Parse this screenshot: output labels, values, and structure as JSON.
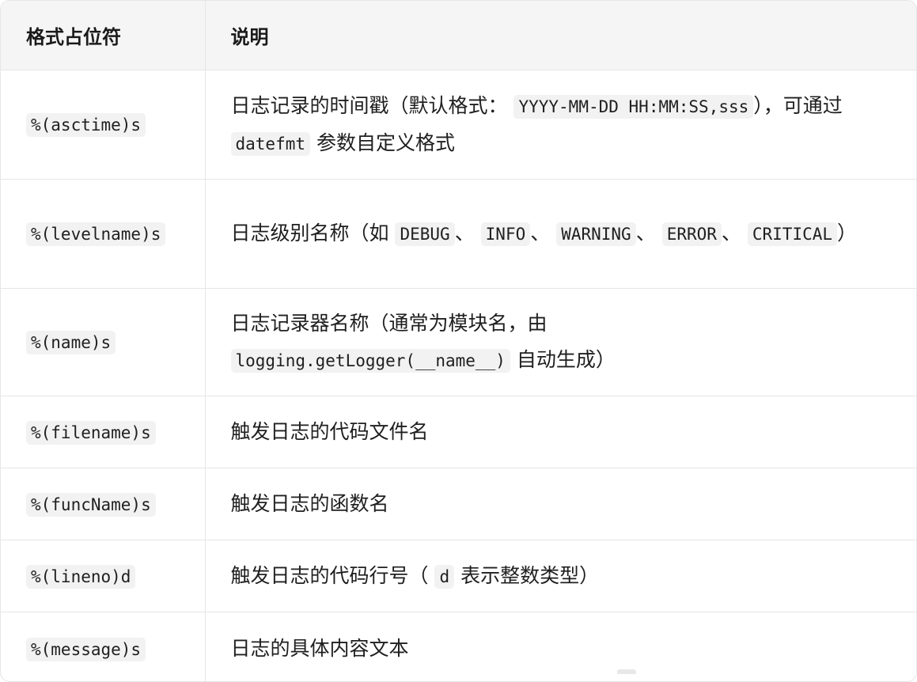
{
  "table": {
    "headers": [
      "格式占位符",
      "说明"
    ],
    "rows": {
      "asctime": {
        "key": "%(asctime)s",
        "desc_a": "日志记录的时间戳（默认格式：",
        "code_a": "YYYY-MM-DD HH:MM:SS,sss",
        "desc_b": "），可通过",
        "code_b": "datefmt",
        "desc_c": "参数自定义格式"
      },
      "levelname": {
        "key": "%(levelname)s",
        "desc_a": "日志级别名称（如",
        "code_a": "DEBUG",
        "sep_a": "、",
        "code_b": "INFO",
        "sep_b": "、",
        "code_c": "WARNING",
        "sep_c": "、",
        "code_d": "ERROR",
        "sep_d": "、",
        "code_e": "CRITICAL",
        "desc_b": "）"
      },
      "name": {
        "key": "%(name)s",
        "desc_a": "日志记录器名称（通常为模块名，由",
        "code_a": "logging.getLogger(__name__)",
        "desc_b": "自动生成）"
      },
      "filename": {
        "key": "%(filename)s",
        "desc": "触发日志的代码文件名"
      },
      "funcName": {
        "key": "%(funcName)s",
        "desc": "触发日志的函数名"
      },
      "lineno": {
        "key": "%(lineno)d",
        "desc_a": "触发日志的代码行号（",
        "code_a": "d",
        "desc_b": "表示整数类型）"
      },
      "message": {
        "key": "%(message)s",
        "desc": "日志的具体内容文本"
      }
    }
  }
}
